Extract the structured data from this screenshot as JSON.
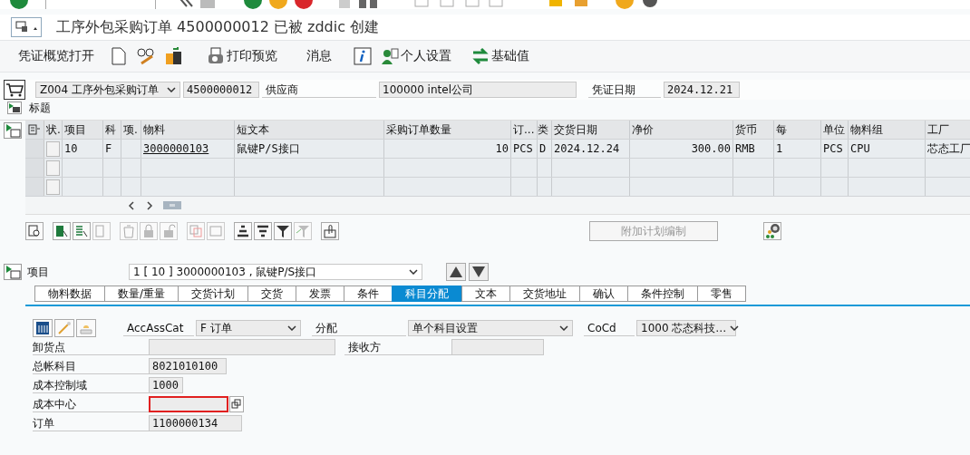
{
  "title": "工序外包采购订单 4500000012 已被 zddic 创建",
  "app_toolbar": {
    "overview_button": "凭证概览打开",
    "print_preview_button": "打印预览",
    "messages_button": "消息",
    "personal_settings_button": "个人设置",
    "basic_values_button": "基础值"
  },
  "header": {
    "order_type": "Z004 工序外包采购订单",
    "po_number": "4500000012",
    "vendor_label": "供应商",
    "vendor": "100000 intel公司",
    "doc_date_label": "凭证日期",
    "doc_date": "2024.12.21"
  },
  "header_section": "标题",
  "items_table": {
    "columns": [
      "状.",
      "项目",
      "科",
      "项.",
      "物料",
      "短文本",
      "采购订单数量",
      "订...",
      "类",
      "交货日期",
      "净价",
      "货币",
      "每",
      "单位",
      "物料组",
      "工厂"
    ],
    "rows": [
      {
        "cells": [
          null,
          "10",
          "F",
          null,
          "3000000103",
          "鼠键P/S接口",
          "10",
          "PCS",
          "D",
          "2024.12.24",
          "300.00",
          "RMB",
          "1",
          "PCS",
          "CPU",
          "芯态工厂"
        ]
      }
    ]
  },
  "schedule_button": {
    "label": "附加计划编制",
    "disabled": true
  },
  "item_selector": {
    "label": "项目",
    "value": "1 [ 10 ] 3000000103 , 鼠键P/S接口"
  },
  "tabs": [
    {
      "label": "物料数据",
      "selected": false
    },
    {
      "label": "数量/重量",
      "selected": false
    },
    {
      "label": "交货计划",
      "selected": false
    },
    {
      "label": "交货",
      "selected": false
    },
    {
      "label": "发票",
      "selected": false
    },
    {
      "label": "条件",
      "selected": false
    },
    {
      "label": "科目分配",
      "selected": true
    },
    {
      "label": "文本",
      "selected": false
    },
    {
      "label": "交货地址",
      "selected": false
    },
    {
      "label": "确认",
      "selected": false
    },
    {
      "label": "条件控制",
      "selected": false
    },
    {
      "label": "零售",
      "selected": false
    }
  ],
  "account_assignment": {
    "category_label": "AccAssCat",
    "category": "F 订单",
    "distribution_label": "分配",
    "distribution": "单个科目设置",
    "company_code_label": "CoCd",
    "company_code": "1000 芯态科技…",
    "recipient_label": "接收方",
    "fields": [
      {
        "label": "卸货点",
        "highlighted": false
      },
      {
        "label": "总帐科目",
        "value": "8021010100",
        "highlighted": false
      },
      {
        "label": "成本控制域",
        "value": "1000",
        "highlighted": false
      },
      {
        "label": "成本中心",
        "highlighted": true
      },
      {
        "label": "订单",
        "value": "1100000134",
        "highlighted": false
      }
    ]
  }
}
